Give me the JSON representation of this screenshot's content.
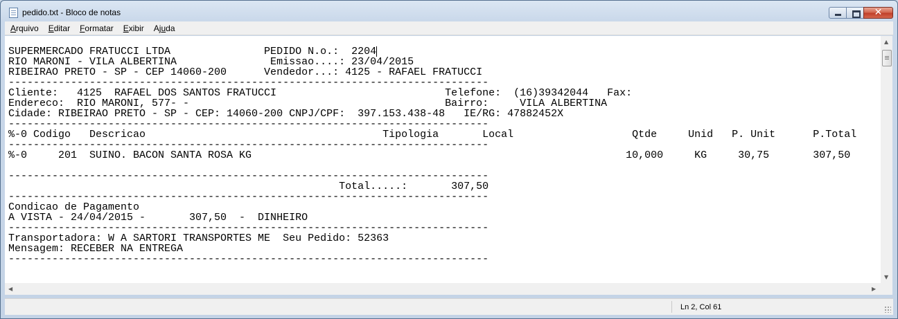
{
  "window": {
    "title": "pedido.txt - Bloco de notas",
    "minimize_label": "",
    "close_glyph": "✕"
  },
  "menu": {
    "items": [
      {
        "accel": "A",
        "rest": "rquivo"
      },
      {
        "accel": "E",
        "rest": "ditar"
      },
      {
        "accel": "F",
        "rest": "ormatar"
      },
      {
        "accel": "E",
        "rest": "xibir"
      },
      {
        "pre": "Aj",
        "accel": "u",
        "rest": "da"
      }
    ]
  },
  "document": {
    "lines": [
      "SUPERMERCADO FRATUCCI LTDA               PEDIDO N.o.:  2204",
      "RIO MARONI - VILA ALBERTINA               Emissao....: 23/04/2015",
      "RIBEIRAO PRETO - SP - CEP 14060-200      Vendedor...: 4125 - RAFAEL FRATUCCI",
      "-----------------------------------------------------------------------------",
      "Cliente:   4125  RAFAEL DOS SANTOS FRATUCCI                           Telefone:  (16)39342044   Fax:",
      "Endereco:  RIO MARONI, 577- -                                         Bairro:     VILA ALBERTINA",
      "Cidade: RIBEIRAO PRETO - SP - CEP: 14060-200 CNPJ/CPF:  397.153.438-48   IE/RG: 47882452X",
      "-----------------------------------------------------------------------------",
      "%-0 Codigo   Descricao                                      Tipologia       Local                   Qtde     Unid   P. Unit      P.Total",
      "-----------------------------------------------------------------------------",
      "%-0     201  SUINO. BACON SANTA ROSA KG                                                            10,000     KG     30,75       307,50",
      "",
      "-----------------------------------------------------------------------------",
      "                                                     Total.....:       307,50",
      "-----------------------------------------------------------------------------",
      "Condicao de Pagamento",
      "A VISTA - 24/04/2015 -       307,50  -  DINHEIRO",
      "-----------------------------------------------------------------------------",
      "Transportadora: W A SARTORI TRANSPORTES ME  Seu Pedido: 52363",
      "Mensagem: RECEBER NA ENTREGA",
      "-----------------------------------------------------------------------------"
    ]
  },
  "status": {
    "position": "Ln 2, Col 61"
  },
  "icons": {
    "app": "notepad-icon",
    "scroll_up": "▲",
    "scroll_down": "▼",
    "scroll_left": "◀",
    "scroll_right": "▶"
  }
}
